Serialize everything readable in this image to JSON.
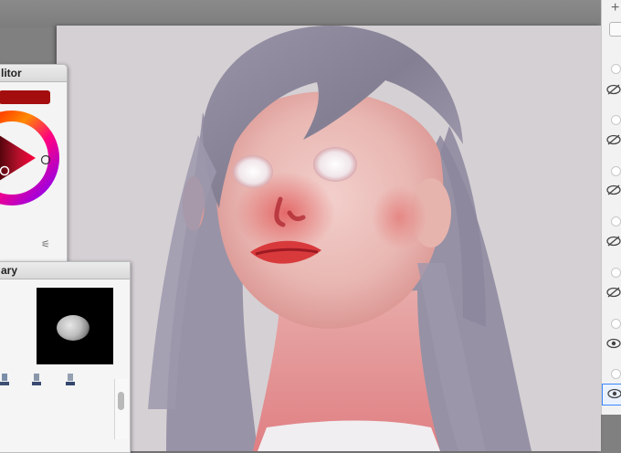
{
  "color_editor": {
    "title": "litor",
    "current_color": "#a40d0d"
  },
  "brush_library": {
    "title": "ary"
  },
  "layers": {
    "add_label": "+",
    "rows": [
      "hidden",
      "hidden",
      "hidden",
      "hidden",
      "hidden",
      "visible",
      "visible"
    ]
  }
}
